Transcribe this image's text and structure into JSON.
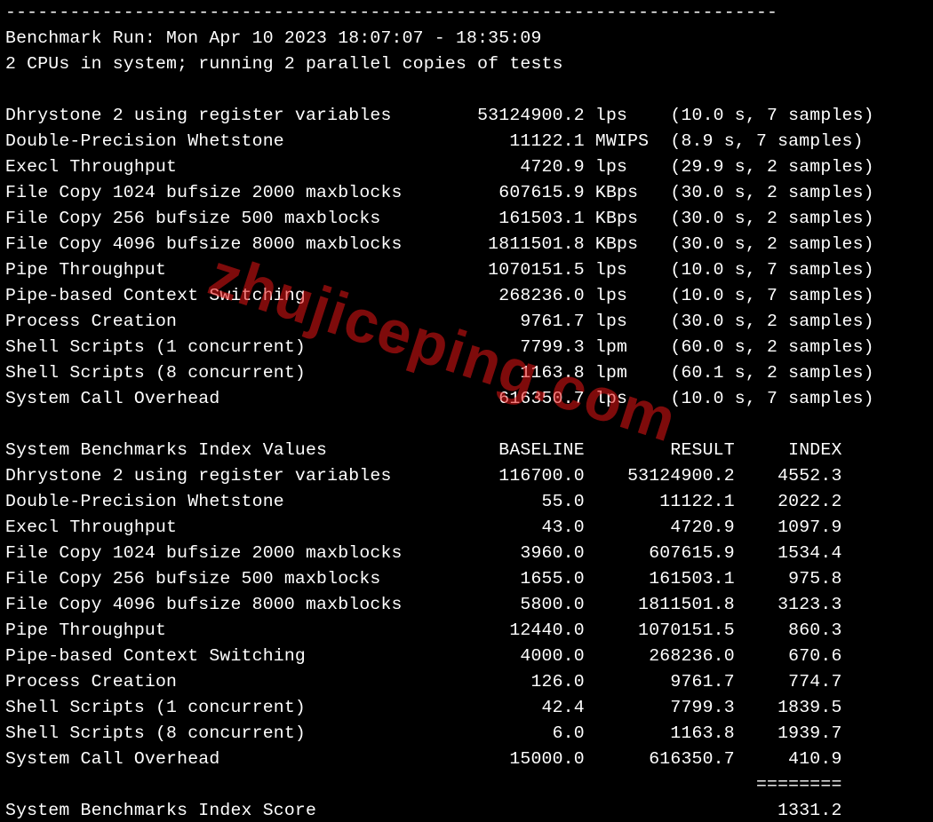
{
  "header": {
    "dashes": "------------------------------------------------------------------------",
    "run_line": "Benchmark Run: Mon Apr 10 2023 18:07:07 - 18:35:09",
    "cpu_line": "2 CPUs in system; running 2 parallel copies of tests"
  },
  "results": [
    {
      "name": "Dhrystone 2 using register variables",
      "value": "53124900.2",
      "unit": "lps",
      "time": "10.0",
      "samples": "7"
    },
    {
      "name": "Double-Precision Whetstone",
      "value": "11122.1",
      "unit": "MWIPS",
      "time": "8.9",
      "samples": "7"
    },
    {
      "name": "Execl Throughput",
      "value": "4720.9",
      "unit": "lps",
      "time": "29.9",
      "samples": "2"
    },
    {
      "name": "File Copy 1024 bufsize 2000 maxblocks",
      "value": "607615.9",
      "unit": "KBps",
      "time": "30.0",
      "samples": "2"
    },
    {
      "name": "File Copy 256 bufsize 500 maxblocks",
      "value": "161503.1",
      "unit": "KBps",
      "time": "30.0",
      "samples": "2"
    },
    {
      "name": "File Copy 4096 bufsize 8000 maxblocks",
      "value": "1811501.8",
      "unit": "KBps",
      "time": "30.0",
      "samples": "2"
    },
    {
      "name": "Pipe Throughput",
      "value": "1070151.5",
      "unit": "lps",
      "time": "10.0",
      "samples": "7"
    },
    {
      "name": "Pipe-based Context Switching",
      "value": "268236.0",
      "unit": "lps",
      "time": "10.0",
      "samples": "7"
    },
    {
      "name": "Process Creation",
      "value": "9761.7",
      "unit": "lps",
      "time": "30.0",
      "samples": "2"
    },
    {
      "name": "Shell Scripts (1 concurrent)",
      "value": "7799.3",
      "unit": "lpm",
      "time": "60.0",
      "samples": "2"
    },
    {
      "name": "Shell Scripts (8 concurrent)",
      "value": "1163.8",
      "unit": "lpm",
      "time": "60.1",
      "samples": "2"
    },
    {
      "name": "System Call Overhead",
      "value": "616350.7",
      "unit": "lps",
      "time": "10.0",
      "samples": "7"
    }
  ],
  "index_table": {
    "title": "System Benchmarks Index Values",
    "cols": {
      "baseline": "BASELINE",
      "result": "RESULT",
      "index": "INDEX"
    },
    "rows": [
      {
        "name": "Dhrystone 2 using register variables",
        "baseline": "116700.0",
        "result": "53124900.2",
        "index": "4552.3"
      },
      {
        "name": "Double-Precision Whetstone",
        "baseline": "55.0",
        "result": "11122.1",
        "index": "2022.2"
      },
      {
        "name": "Execl Throughput",
        "baseline": "43.0",
        "result": "4720.9",
        "index": "1097.9"
      },
      {
        "name": "File Copy 1024 bufsize 2000 maxblocks",
        "baseline": "3960.0",
        "result": "607615.9",
        "index": "1534.4"
      },
      {
        "name": "File Copy 256 bufsize 500 maxblocks",
        "baseline": "1655.0",
        "result": "161503.1",
        "index": "975.8"
      },
      {
        "name": "File Copy 4096 bufsize 8000 maxblocks",
        "baseline": "5800.0",
        "result": "1811501.8",
        "index": "3123.3"
      },
      {
        "name": "Pipe Throughput",
        "baseline": "12440.0",
        "result": "1070151.5",
        "index": "860.3"
      },
      {
        "name": "Pipe-based Context Switching",
        "baseline": "4000.0",
        "result": "268236.0",
        "index": "670.6"
      },
      {
        "name": "Process Creation",
        "baseline": "126.0",
        "result": "9761.7",
        "index": "774.7"
      },
      {
        "name": "Shell Scripts (1 concurrent)",
        "baseline": "42.4",
        "result": "7799.3",
        "index": "1839.5"
      },
      {
        "name": "Shell Scripts (8 concurrent)",
        "baseline": "6.0",
        "result": "1163.8",
        "index": "1939.7"
      },
      {
        "name": "System Call Overhead",
        "baseline": "15000.0",
        "result": "616350.7",
        "index": "410.9"
      }
    ]
  },
  "footer": {
    "separator": "========",
    "score_label": "System Benchmarks Index Score",
    "score_value": "1331.2"
  },
  "watermark": "zhujiceping.com"
}
